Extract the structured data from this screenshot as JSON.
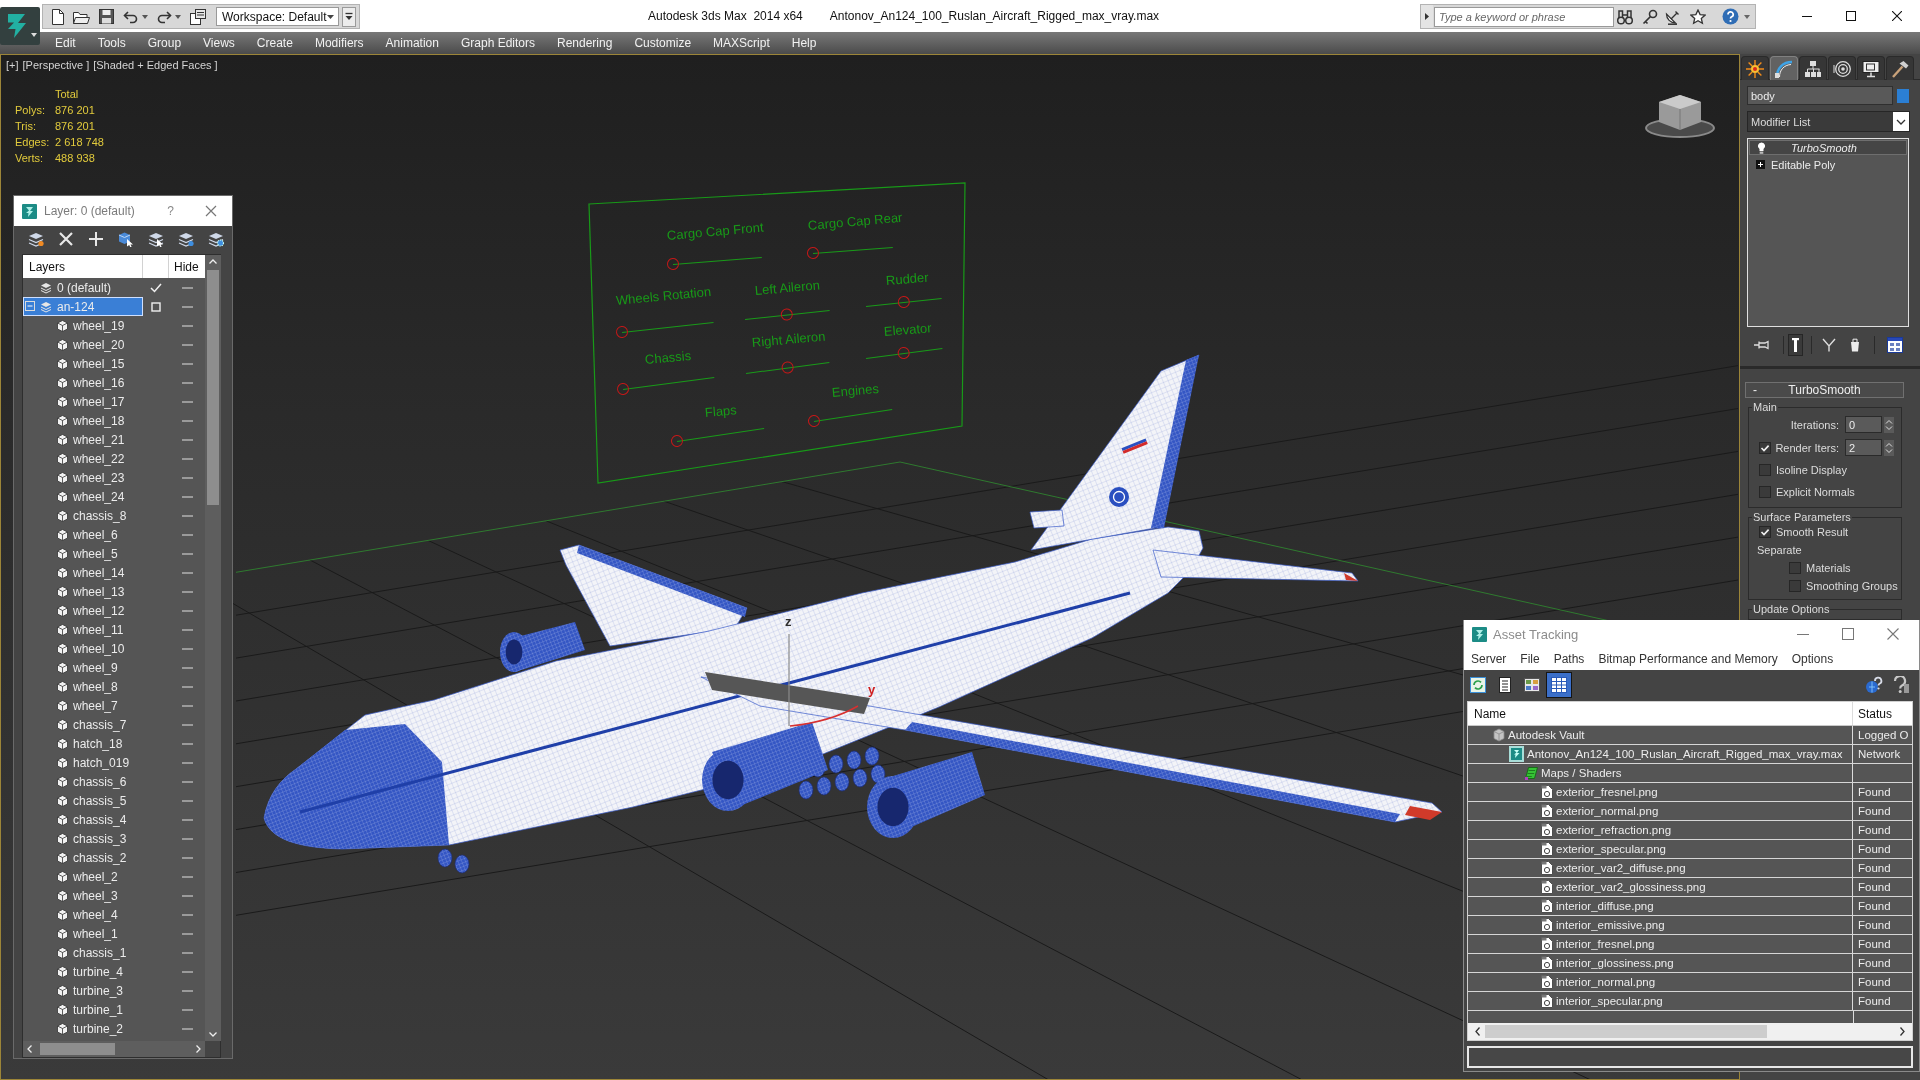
{
  "title_bar": {
    "workspace": "Workspace: Default",
    "app_title": "Autodesk 3ds Max  2014 x64",
    "file_title": "Antonov_An124_100_Ruslan_Aircraft_Rigged_max_vray.max",
    "search": {
      "placeholder": "Type a keyword or phrase"
    }
  },
  "menu": [
    "Edit",
    "Tools",
    "Group",
    "Views",
    "Create",
    "Modifiers",
    "Animation",
    "Graph Editors",
    "Rendering",
    "Customize",
    "MAXScript",
    "Help"
  ],
  "viewport": {
    "labels": [
      "[+]",
      "[Perspective ]",
      "[Shaded + Edged Faces ]"
    ],
    "statistics": {
      "header": "Total",
      "rows": [
        {
          "label": "Polys:",
          "value": "876 201"
        },
        {
          "label": "Tris:",
          "value": "876 201"
        },
        {
          "label": "Edges:",
          "value": "2 618 748"
        },
        {
          "label": "Verts:",
          "value": "488 938"
        }
      ]
    },
    "rig_controls": [
      {
        "label": "Cargo Cap Front",
        "level": 0
      },
      {
        "label": "Cargo Cap Rear",
        "level": 0
      },
      {
        "label": "Wheels Rotation",
        "level": 0
      },
      {
        "label": "Left Aileron",
        "level": 0.5
      },
      {
        "label": "Rudder",
        "level": 0.5
      },
      {
        "label": "Chassis",
        "level": 0
      },
      {
        "label": "Right Aileron",
        "level": 0.5
      },
      {
        "label": "Elevator",
        "level": 0.5
      },
      {
        "label": "Flaps",
        "level": 0
      },
      {
        "label": "Engines",
        "level": 0
      }
    ],
    "gizmo_labels": [
      "z",
      "y"
    ]
  },
  "layer_explorer": {
    "title": "Layer: 0 (default)",
    "help": "?",
    "columns": [
      "Layers",
      "Hide"
    ],
    "layers": [
      {
        "name": "0 (default)",
        "current": true,
        "selected": false
      },
      {
        "name": "an-124",
        "current": false,
        "selected": true,
        "expanded": true,
        "children": [
          {
            "name": "wheel_19",
            "selected": false
          },
          {
            "name": "wheel_20",
            "selected": false
          },
          {
            "name": "wheel_15",
            "selected": false
          },
          {
            "name": "wheel_16",
            "selected": false
          },
          {
            "name": "wheel_17",
            "selected": false
          },
          {
            "name": "wheel_18",
            "selected": false
          },
          {
            "name": "wheel_21",
            "selected": false
          },
          {
            "name": "wheel_22",
            "selected": false
          },
          {
            "name": "wheel_23",
            "selected": false
          },
          {
            "name": "wheel_24",
            "selected": false
          },
          {
            "name": "chassis_8",
            "selected": false
          },
          {
            "name": "wheel_6",
            "selected": false
          },
          {
            "name": "wheel_5",
            "selected": false
          },
          {
            "name": "wheel_14",
            "selected": false
          },
          {
            "name": "wheel_13",
            "selected": false
          },
          {
            "name": "wheel_12",
            "selected": false
          },
          {
            "name": "wheel_11",
            "selected": false
          },
          {
            "name": "wheel_10",
            "selected": false
          },
          {
            "name": "wheel_9",
            "selected": false
          },
          {
            "name": "wheel_8",
            "selected": false
          },
          {
            "name": "wheel_7",
            "selected": false
          },
          {
            "name": "chassis_7",
            "selected": false
          },
          {
            "name": "hatch_18",
            "selected": false
          },
          {
            "name": "hatch_019",
            "selected": false
          },
          {
            "name": "chassis_6",
            "selected": false
          },
          {
            "name": "chassis_5",
            "selected": false
          },
          {
            "name": "chassis_4",
            "selected": false
          },
          {
            "name": "chassis_3",
            "selected": false
          },
          {
            "name": "chassis_2",
            "selected": false
          },
          {
            "name": "wheel_2",
            "selected": false
          },
          {
            "name": "wheel_3",
            "selected": false
          },
          {
            "name": "wheel_4",
            "selected": false
          },
          {
            "name": "wheel_1",
            "selected": false
          },
          {
            "name": "chassis_1",
            "selected": false
          },
          {
            "name": "turbine_4",
            "selected": false
          },
          {
            "name": "turbine_3",
            "selected": false
          },
          {
            "name": "turbine_1",
            "selected": false
          },
          {
            "name": "turbine_2",
            "selected": false
          }
        ]
      }
    ]
  },
  "command_panel": {
    "tabs": [
      {
        "selected": false
      },
      {
        "selected": true
      },
      {
        "selected": false
      },
      {
        "selected": false
      },
      {
        "selected": false
      },
      {
        "selected": false
      }
    ],
    "object_name": "body",
    "modifier_list": "Modifier List",
    "stack": [
      {
        "name": "TurboSmooth",
        "kind": "modifier",
        "selected": true,
        "enabled_in_viewport": false
      },
      {
        "name": "Editable Poly",
        "kind": "base_object",
        "selected": false,
        "enabled_in_viewport": true,
        "expanded": false
      }
    ],
    "stack_tools": [
      {
        "on": false
      },
      {
        "on": true
      },
      {
        "on": false
      },
      {
        "on": false
      },
      {
        "on": false
      }
    ],
    "rollout": {
      "sign": "-",
      "title": "TurboSmooth",
      "groups": [
        {
          "title": "Main",
          "items": [
            {
              "kind": "spinner",
              "label": "Iterations:",
              "value": "0"
            },
            {
              "kind": "check_spinner",
              "label": "Render Iters:",
              "checked": true,
              "value": "2"
            },
            {
              "kind": "checkbox",
              "label": "Isoline Display",
              "checked": false
            },
            {
              "kind": "checkbox",
              "label": "Explicit Normals",
              "checked": false
            }
          ]
        },
        {
          "title": "Surface Parameters",
          "items": [
            {
              "kind": "checkbox",
              "label": "Smooth Result",
              "checked": true
            },
            {
              "kind": "heading",
              "label": "Separate",
              "children": [
                {
                  "kind": "checkbox",
                  "label": "Materials",
                  "checked": false
                },
                {
                  "kind": "checkbox",
                  "label": "Smoothing Groups",
                  "checked": false
                }
              ]
            }
          ]
        },
        {
          "title": "Update Options"
        }
      ]
    }
  },
  "asset_tracking": {
    "title": "Asset Tracking",
    "menu": [
      "Server",
      "File",
      "Paths",
      "Bitmap Performance and Memory",
      "Options"
    ],
    "toolbar_buttons": [
      {
        "selected": false
      },
      {
        "selected": false
      },
      {
        "selected": false
      },
      {
        "selected": true
      }
    ],
    "columns": [
      "Name",
      "Status"
    ],
    "rows": [
      {
        "name": "Autodesk Vault",
        "kind": "vault",
        "status": "Logged O",
        "selected": false,
        "children": [
          {
            "name": "Antonov_An124_100_Ruslan_Aircraft_Rigged_max_vray.max",
            "kind": "scene",
            "status": "Network",
            "selected": false,
            "children": [
              {
                "name": "Maps / Shaders",
                "kind": "maps",
                "selected": false,
                "children": [
                  {
                    "name": "exterior_fresnel.png",
                    "kind": "bitmap",
                    "status": "Found",
                    "selected": false
                  },
                  {
                    "name": "exterior_normal.png",
                    "kind": "bitmap",
                    "status": "Found",
                    "selected": false
                  },
                  {
                    "name": "exterior_refraction.png",
                    "kind": "bitmap",
                    "status": "Found",
                    "selected": false
                  },
                  {
                    "name": "exterior_specular.png",
                    "kind": "bitmap",
                    "status": "Found",
                    "selected": false
                  },
                  {
                    "name": "exterior_var2_diffuse.png",
                    "kind": "bitmap",
                    "status": "Found",
                    "selected": false
                  },
                  {
                    "name": "exterior_var2_glossiness.png",
                    "kind": "bitmap",
                    "status": "Found",
                    "selected": false
                  },
                  {
                    "name": "interior_diffuse.png",
                    "kind": "bitmap",
                    "status": "Found",
                    "selected": false
                  },
                  {
                    "name": "interior_emissive.png",
                    "kind": "bitmap",
                    "status": "Found",
                    "selected": false
                  },
                  {
                    "name": "interior_fresnel.png",
                    "kind": "bitmap",
                    "status": "Found",
                    "selected": false
                  },
                  {
                    "name": "interior_glossiness.png",
                    "kind": "bitmap",
                    "status": "Found",
                    "selected": false
                  },
                  {
                    "name": "interior_normal.png",
                    "kind": "bitmap",
                    "status": "Found",
                    "selected": false
                  },
                  {
                    "name": "interior_specular.png",
                    "kind": "bitmap",
                    "status": "Found",
                    "selected": false
                  }
                ]
              }
            ]
          }
        ]
      }
    ]
  }
}
